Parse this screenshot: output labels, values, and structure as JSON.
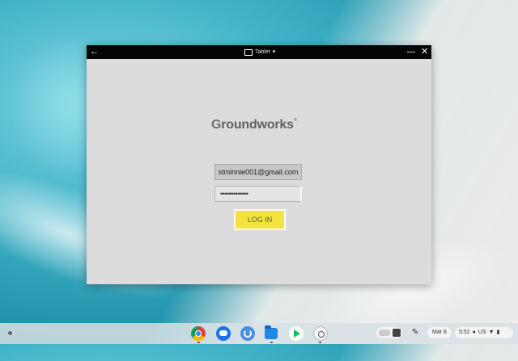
{
  "window": {
    "titlebar": {
      "back_icon": "←",
      "app_label": "Tablet",
      "dropdown_icon": "▾",
      "minimize_icon": "—",
      "close_icon": "✕"
    },
    "logo": {
      "first_letter": "G",
      "rest": "roundworks",
      "registered": "®"
    },
    "form": {
      "email_value": "stminnie001@gmail.com",
      "password_value": "•••••••••••••",
      "login_label": "LOG IN"
    },
    "colors": {
      "login_button": "#f2e33f",
      "window_bg": "#dcdcdc"
    }
  },
  "shelf": {
    "apps": [
      "chrome-icon",
      "chat-icon",
      "stats-icon",
      "files-icon",
      "play-store-icon",
      "app-icon"
    ],
    "pen_icon": "✎",
    "date": "Mar 8",
    "time": "5:52",
    "locale": "US",
    "status_icons": {
      "notification": "●",
      "wifi": "▼",
      "battery": "▮"
    }
  }
}
